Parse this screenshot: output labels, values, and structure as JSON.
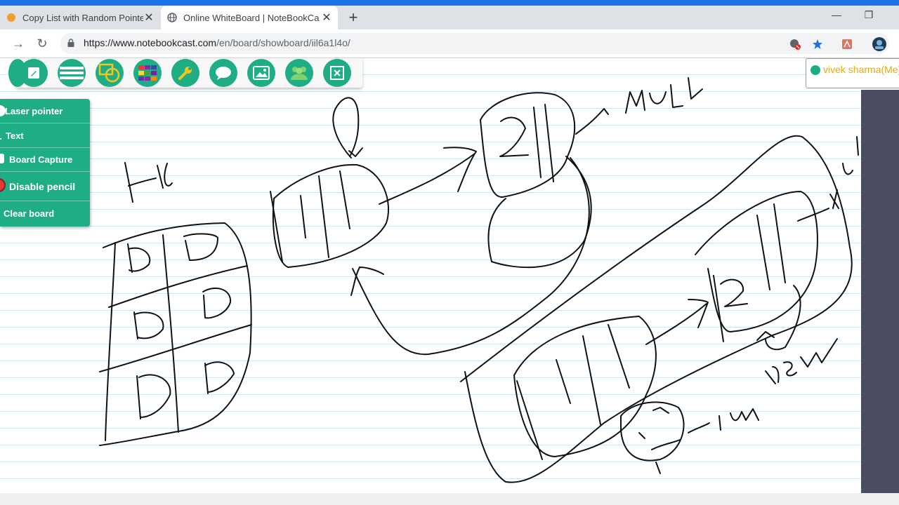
{
  "browser": {
    "tabs": [
      {
        "title": "Copy List with Random Pointer -",
        "active": false
      },
      {
        "title": "Online WhiteBoard | NoteBookCa",
        "active": true
      }
    ],
    "new_tab": "+",
    "window_controls": {
      "minimize": "—",
      "restore": "❐"
    },
    "address": {
      "host": "https://www.notebookcast.com",
      "path": "/en/board/showboard/iil6a1l4o/"
    },
    "nav_icons": [
      "forward-icon",
      "reload-icon",
      "lock-icon"
    ],
    "extension_icons": [
      "translate-blocked-icon",
      "bookmark-star-icon",
      "pdf-icon",
      "profile-avatar-icon"
    ]
  },
  "toolbar": {
    "tools": [
      {
        "name": "pencil-tool",
        "icon": "pencil-icon"
      },
      {
        "name": "line-width-tool",
        "icon": "lines-icon"
      },
      {
        "name": "shapes-tool",
        "icon": "shapes-icon"
      },
      {
        "name": "color-tool",
        "icon": "palette-grid-icon"
      },
      {
        "name": "settings-tool",
        "icon": "wrench-icon"
      },
      {
        "name": "chat-tool",
        "icon": "chat-icon"
      },
      {
        "name": "image-tool",
        "icon": "image-icon"
      },
      {
        "name": "users-tool",
        "icon": "users-icon"
      },
      {
        "name": "close-tool",
        "icon": "close-icon"
      }
    ]
  },
  "side_menu": {
    "items": [
      {
        "label": "Laser pointer",
        "icon": "laser-icon"
      },
      {
        "label": "Text",
        "icon": "text-icon"
      },
      {
        "label": "Board Capture",
        "icon": "camera-icon"
      },
      {
        "label": "Disable pencil",
        "icon": "pencil-off-icon"
      },
      {
        "label": "Clear board",
        "icon": "trash-icon"
      }
    ]
  },
  "user": {
    "name": "vivek sharma(Me)",
    "status_color": "#1fad85"
  },
  "colors": {
    "accent": "#1fad85",
    "tab_strip": "#dee1e6",
    "side_panel": "#4b4d63",
    "ruled_line": "#cfe6f3",
    "username": "#e6a817"
  }
}
